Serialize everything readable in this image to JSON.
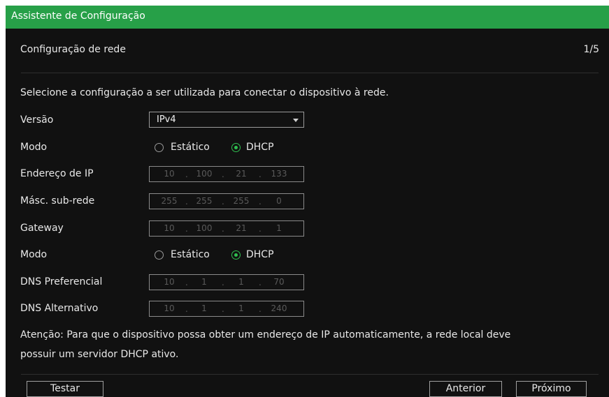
{
  "window": {
    "title": "Assistente de Configuração"
  },
  "header": {
    "subtitle": "Configuração de rede",
    "page_indicator": "1/5"
  },
  "intro": "Selecione a configuração a ser utilizada para conectar o dispositivo à rede.",
  "labels": {
    "version": "Versão",
    "mode": "Modo",
    "ip": "Endereço de IP",
    "mask": "Másc. sub-rede",
    "gateway": "Gateway",
    "mode2": "Modo",
    "dns1": "DNS Preferencial",
    "dns2": "DNS Alternativo"
  },
  "version_value": "IPv4",
  "mode_options": {
    "static": "Estático",
    "dhcp": "DHCP",
    "selected": "DHCP"
  },
  "ip": [
    "10",
    "100",
    "21",
    "133"
  ],
  "mask": [
    "255",
    "255",
    "255",
    "0"
  ],
  "gateway": [
    "10",
    "100",
    "21",
    "1"
  ],
  "dns_mode": {
    "static": "Estático",
    "dhcp": "DHCP",
    "selected": "DHCP"
  },
  "dns1": [
    "10",
    "1",
    "1",
    "70"
  ],
  "dns2": [
    "10",
    "1",
    "1",
    "240"
  ],
  "note": {
    "line1": "Atenção: Para que o dispositivo possa obter um endereço de IP automaticamente, a rede local deve",
    "line2": "possuir um servidor DHCP ativo."
  },
  "buttons": {
    "test": "Testar",
    "previous": "Anterior",
    "next": "Próximo"
  },
  "colors": {
    "accent": "#27a048",
    "radio_selected": "#2fbf4f",
    "background": "#111111"
  }
}
